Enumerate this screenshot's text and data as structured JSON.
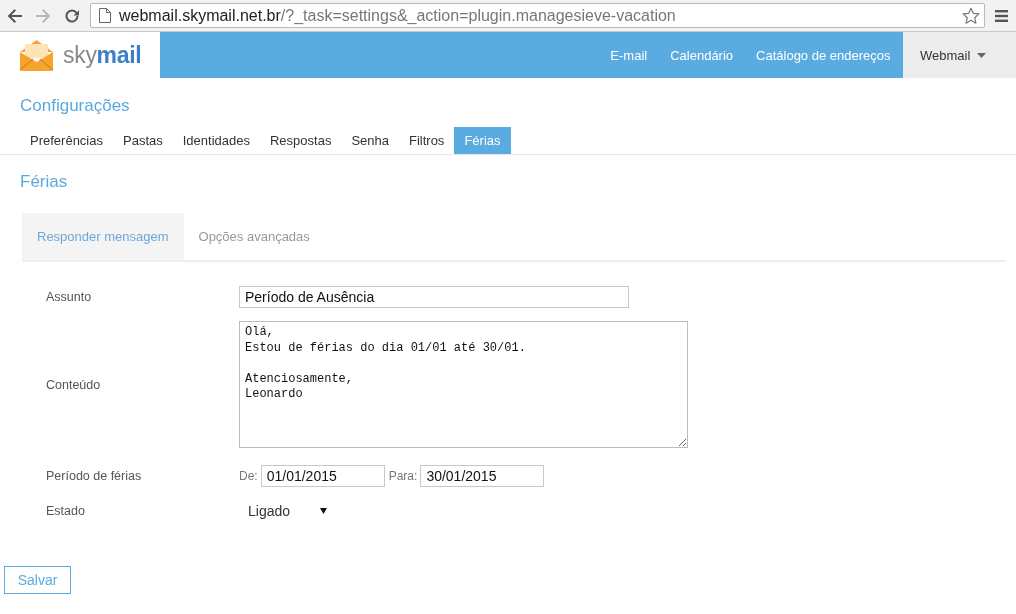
{
  "browser": {
    "url_host": "webmail.skymail.net.br",
    "url_path": "/?_task=settings&_action=plugin.managesieve-vacation"
  },
  "header": {
    "logo_text": "sky**mail**",
    "nav": [
      {
        "label": "E-mail"
      },
      {
        "label": "Calendário"
      },
      {
        "label": "Catálogo de endereços"
      }
    ],
    "account_menu": {
      "label": "Webmail"
    }
  },
  "page_title": "Configurações",
  "tabs": [
    {
      "label": "Preferências",
      "selected": false
    },
    {
      "label": "Pastas",
      "selected": false
    },
    {
      "label": "Identidades",
      "selected": false
    },
    {
      "label": "Respostas",
      "selected": false
    },
    {
      "label": "Senha",
      "selected": false
    },
    {
      "label": "Filtros",
      "selected": false
    },
    {
      "label": "Férias",
      "selected": true
    }
  ],
  "section_title": "Férias",
  "subtabs": [
    {
      "label": "Responder mensagem",
      "selected": true
    },
    {
      "label": "Opções avançadas",
      "selected": false
    }
  ],
  "form": {
    "fields": [
      {
        "kind": "text",
        "label": "Assunto",
        "value": "Período de Ausência"
      },
      {
        "kind": "textarea",
        "label": "Conteúdo",
        "value": "Olá,\nEstou de férias do dia 01/01 até 30/01.\n\nAtenciosamente,\nLeonardo"
      },
      {
        "kind": "date_range",
        "label": "Período de férias",
        "from_label": "De:",
        "from_value": "01/01/2015",
        "to_label": "Para:",
        "to_value": "30/01/2015"
      },
      {
        "kind": "select",
        "label": "Estado",
        "value": "Ligado"
      }
    ]
  },
  "save_button": "Salvar"
}
